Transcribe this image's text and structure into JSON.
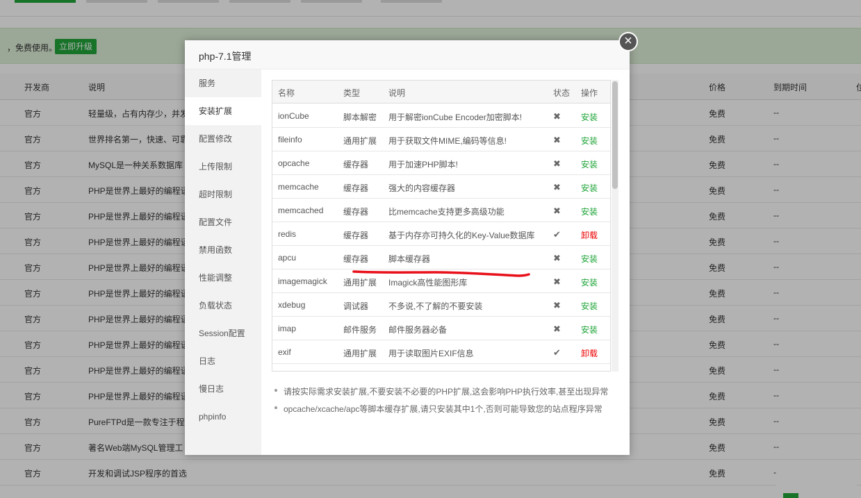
{
  "background": {
    "notice_text": "，免费使用。",
    "upgrade_button": "立即升级",
    "columns": {
      "developer": "开发商",
      "description": "说明",
      "price": "价格",
      "expiry": "到期时间",
      "extra": "位"
    },
    "rows": [
      {
        "developer": "官方",
        "description": "轻量级，占有内存少，并发",
        "price": "免费",
        "expiry": "--"
      },
      {
        "developer": "官方",
        "description": "世界排名第一，快速、可靠",
        "price": "免费",
        "expiry": "--"
      },
      {
        "developer": "官方",
        "description": "MySQL是一种关系数据库",
        "price": "免费",
        "expiry": "--"
      },
      {
        "developer": "官方",
        "description": "PHP是世界上最好的编程语",
        "price": "免费",
        "expiry": "--"
      },
      {
        "developer": "官方",
        "description": "PHP是世界上最好的编程语",
        "price": "免费",
        "expiry": "--"
      },
      {
        "developer": "官方",
        "description": "PHP是世界上最好的编程语",
        "price": "免费",
        "expiry": "--"
      },
      {
        "developer": "官方",
        "description": "PHP是世界上最好的编程语",
        "price": "免费",
        "expiry": "--"
      },
      {
        "developer": "官方",
        "description": "PHP是世界上最好的编程语",
        "price": "免费",
        "expiry": "--"
      },
      {
        "developer": "官方",
        "description": "PHP是世界上最好的编程语",
        "price": "免费",
        "expiry": "--"
      },
      {
        "developer": "官方",
        "description": "PHP是世界上最好的编程语",
        "price": "免费",
        "expiry": "--"
      },
      {
        "developer": "官方",
        "description": "PHP是世界上最好的编程语",
        "price": "免费",
        "expiry": "--"
      },
      {
        "developer": "官方",
        "description": "PHP是世界上最好的编程语",
        "price": "免费",
        "expiry": "--"
      },
      {
        "developer": "官方",
        "description": "PureFTPd是一款专注于程",
        "price": "免费",
        "expiry": "--"
      },
      {
        "developer": "官方",
        "description": "著名Web端MySQL管理工",
        "price": "免费",
        "expiry": "--"
      },
      {
        "developer": "官方",
        "description": "开发和调试JSP程序的首选",
        "price": "免费",
        "expiry": "-"
      }
    ]
  },
  "modal": {
    "title": "php-7.1管理",
    "close_icon": "close-icon",
    "nav": [
      "服务",
      "安装扩展",
      "配置修改",
      "上传限制",
      "超时限制",
      "配置文件",
      "禁用函数",
      "性能调整",
      "负载状态",
      "Session配置",
      "日志",
      "慢日志",
      "phpinfo"
    ],
    "active_nav": "安装扩展",
    "table": {
      "headers": {
        "name": "名称",
        "type": "类型",
        "desc": "说明",
        "status": "状态",
        "op": "操作"
      },
      "rows": [
        {
          "name": "ionCube",
          "type": "脚本解密",
          "desc": "用于解密ionCube Encoder加密脚本!",
          "status": "✖",
          "op": "安装",
          "installed": false
        },
        {
          "name": "fileinfo",
          "type": "通用扩展",
          "desc": "用于获取文件MIME,编码等信息!",
          "status": "✖",
          "op": "安装",
          "installed": false
        },
        {
          "name": "opcache",
          "type": "缓存器",
          "desc": "用于加速PHP脚本!",
          "status": "✖",
          "op": "安装",
          "installed": false
        },
        {
          "name": "memcache",
          "type": "缓存器",
          "desc": "强大的内容缓存器",
          "status": "✖",
          "op": "安装",
          "installed": false
        },
        {
          "name": "memcached",
          "type": "缓存器",
          "desc": "比memcache支持更多高级功能",
          "status": "✖",
          "op": "安装",
          "installed": false
        },
        {
          "name": "redis",
          "type": "缓存器",
          "desc": "基于内存亦可持久化的Key-Value数据库",
          "status": "✔",
          "op": "卸载",
          "installed": true
        },
        {
          "name": "apcu",
          "type": "缓存器",
          "desc": "脚本缓存器",
          "status": "✖",
          "op": "安装",
          "installed": false
        },
        {
          "name": "imagemagick",
          "type": "通用扩展",
          "desc": "Imagick高性能图形库",
          "status": "✖",
          "op": "安装",
          "installed": false
        },
        {
          "name": "xdebug",
          "type": "调试器",
          "desc": "不多说,不了解的不要安装",
          "status": "✖",
          "op": "安装",
          "installed": false
        },
        {
          "name": "imap",
          "type": "邮件服务",
          "desc": "邮件服务器必备",
          "status": "✖",
          "op": "安装",
          "installed": false
        },
        {
          "name": "exif",
          "type": "通用扩展",
          "desc": "用于读取图片EXIF信息",
          "status": "✔",
          "op": "卸载",
          "installed": true
        }
      ]
    },
    "notes": [
      "请按实际需求安装扩展,不要安装不必要的PHP扩展,这会影响PHP执行效率,甚至出现异常",
      "opcache/xcache/apc等脚本缓存扩展,请只安装其中1个,否则可能导致您的站点程序异常"
    ]
  },
  "colors": {
    "accent_green": "#20a53a",
    "uninstall_red": "#e00",
    "annotation_red": "#e8101a"
  }
}
